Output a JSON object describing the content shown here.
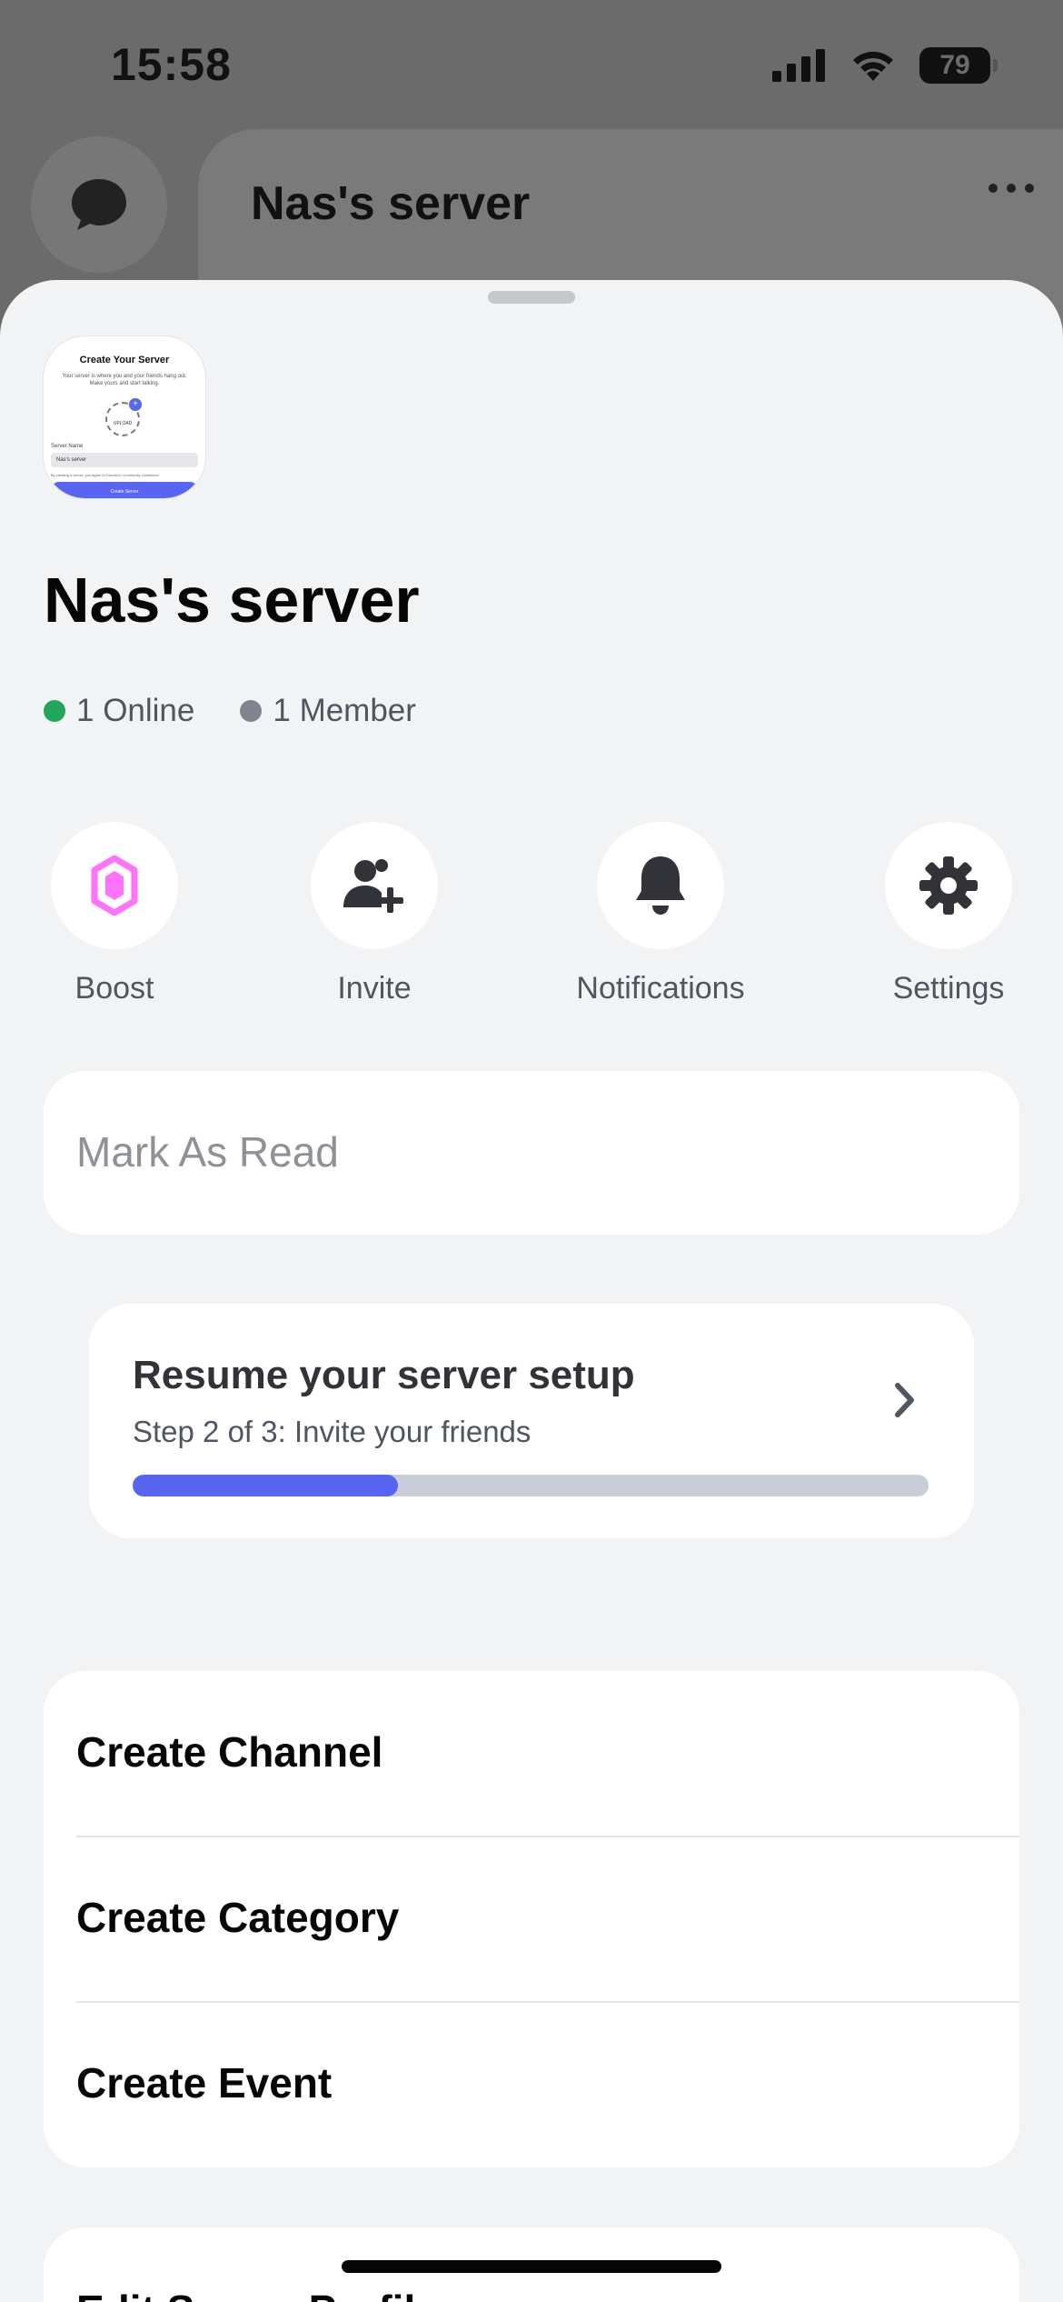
{
  "status_bar": {
    "time": "15:58",
    "battery": "79",
    "icons": [
      "signal-icon",
      "wifi-icon",
      "battery-icon"
    ]
  },
  "background": {
    "server_title": "Nas's server"
  },
  "server_thumbnail": {
    "title": "Create Your Server",
    "description": "Your server is where you and your friends hang out. Make yours and start talking.",
    "upload_label": "UPLOAD",
    "field_label": "Server Name",
    "field_value": "Nas's server",
    "terms_text": "By creating a server, you agree to Discord's Community Guidelines",
    "button_label": "Create Server"
  },
  "server": {
    "name": "Nas's server",
    "online": "1 Online",
    "members": "1 Member"
  },
  "actions": [
    {
      "label": "Boost",
      "icon": "boost-gem-icon"
    },
    {
      "label": "Invite",
      "icon": "invite-user-icon"
    },
    {
      "label": "Notifications",
      "icon": "bell-icon"
    },
    {
      "label": "Settings",
      "icon": "gear-icon"
    }
  ],
  "mark_read": {
    "label": "Mark As Read"
  },
  "setup": {
    "title": "Resume your server setup",
    "step": "Step 2 of 3: Invite your friends",
    "progress": 0.333
  },
  "create_list": [
    {
      "label": "Create Channel"
    },
    {
      "label": "Create Category"
    },
    {
      "label": "Create Event"
    }
  ],
  "edit_profile": {
    "label": "Edit Server Profile"
  },
  "colors": {
    "accent": "#5865f2",
    "online": "#23a55a",
    "member": "#80848e",
    "boost": "#ff73fa"
  }
}
